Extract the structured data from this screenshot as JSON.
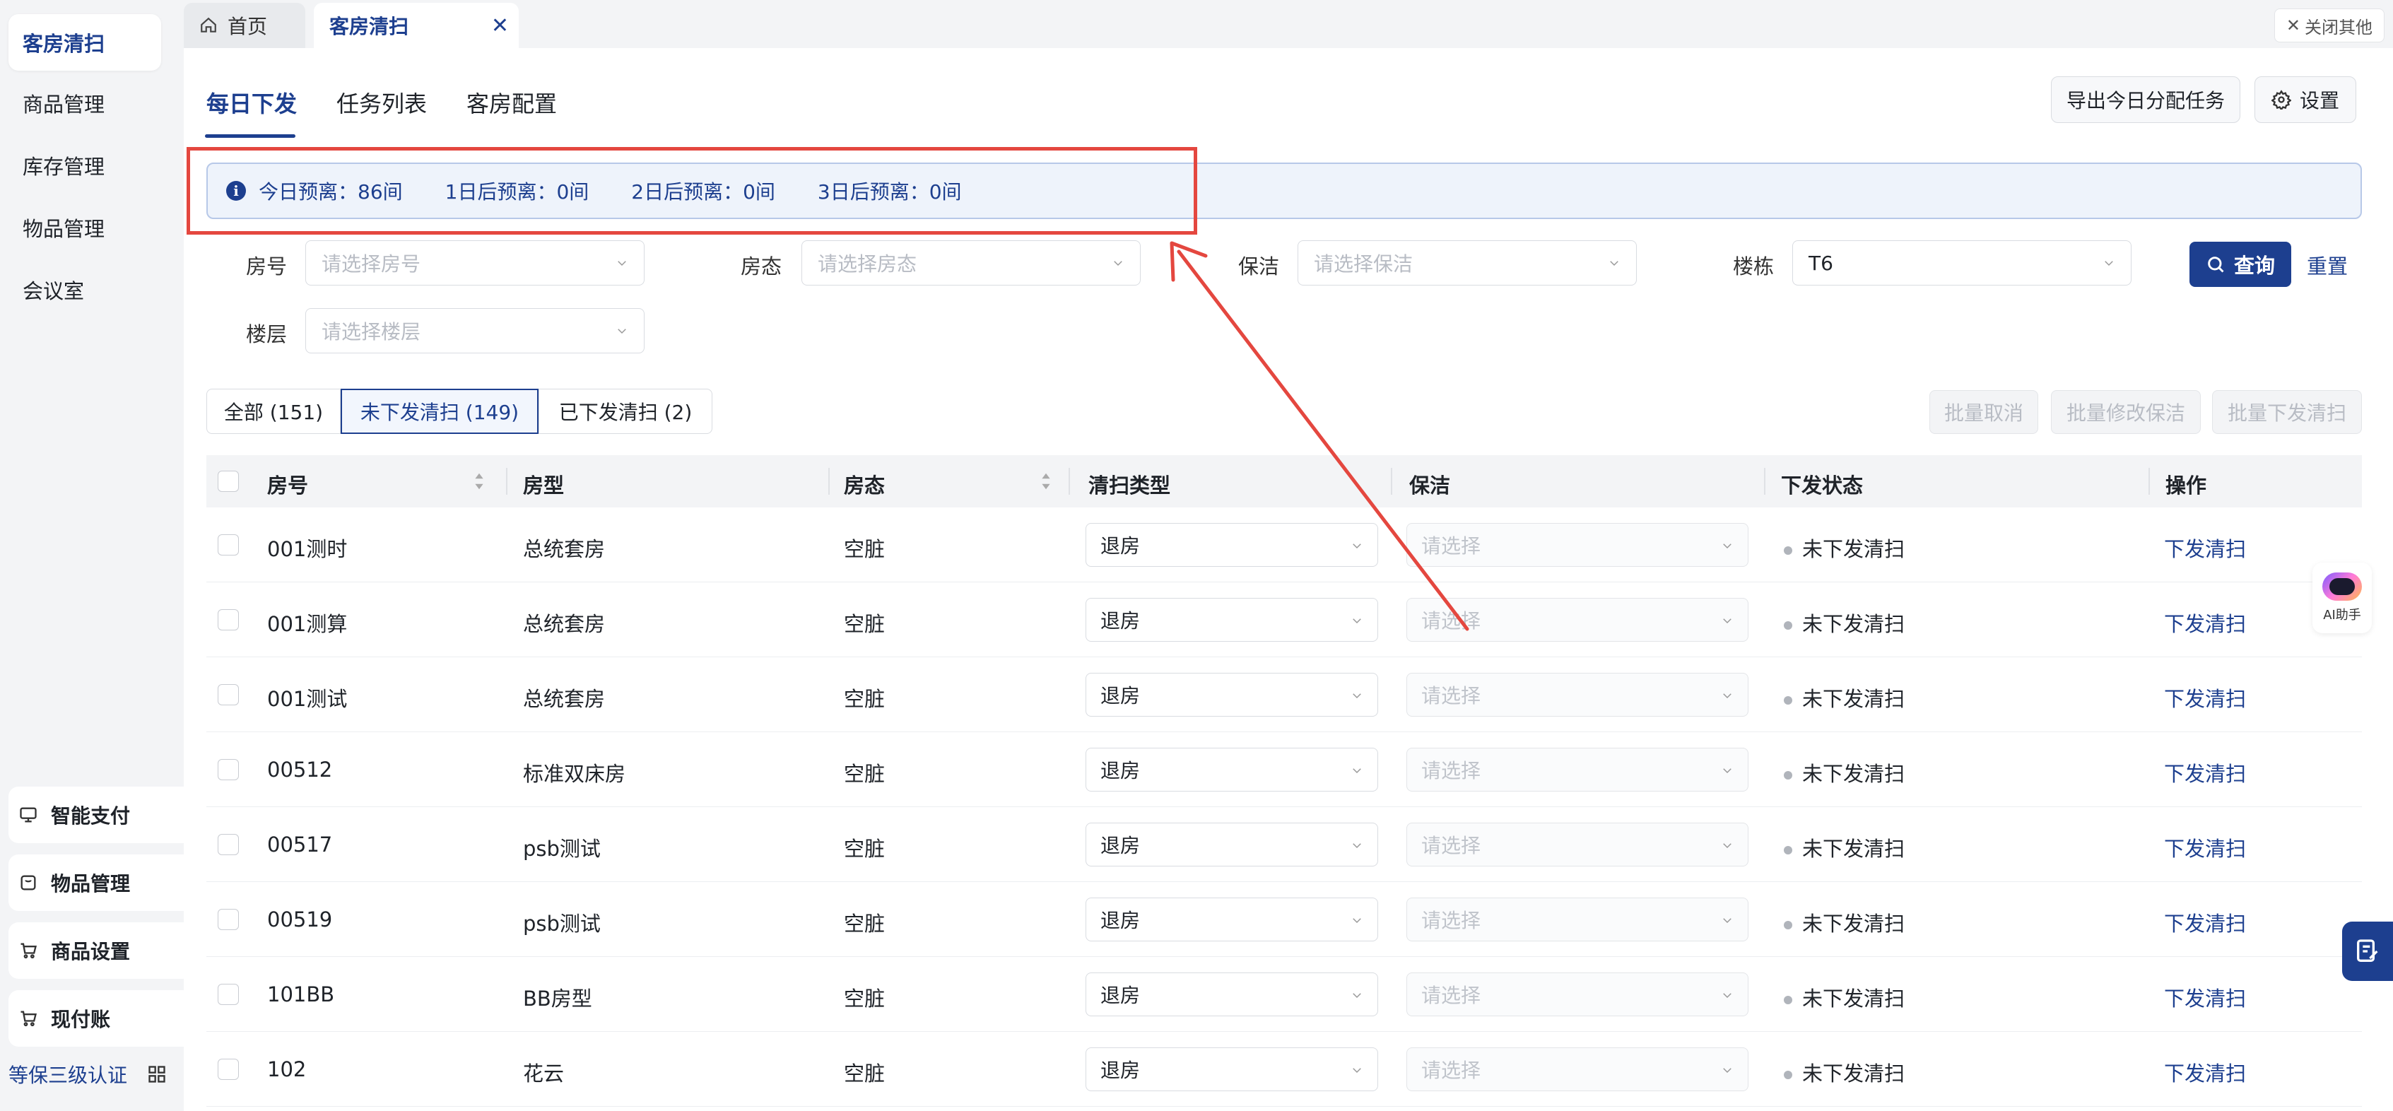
{
  "sidebar": {
    "items": [
      {
        "label": "客房清扫",
        "active": true
      },
      {
        "label": "商品管理"
      },
      {
        "label": "库存管理"
      },
      {
        "label": "物品管理"
      },
      {
        "label": "会议室"
      }
    ],
    "bottom_items": [
      {
        "label": "智能支付",
        "icon": "monitor-icon"
      },
      {
        "label": "物品管理",
        "icon": "box-icon"
      },
      {
        "label": "商品设置",
        "icon": "cart-icon"
      },
      {
        "label": "现付账",
        "icon": "cart-icon"
      }
    ],
    "cert_label": "等保三级认证"
  },
  "tabs": {
    "home": "首页",
    "active": "客房清扫",
    "close_others": "关闭其他"
  },
  "subtabs": [
    "每日下发",
    "任务列表",
    "客房配置"
  ],
  "toolbar": {
    "export_label": "导出今日分配任务",
    "settings_label": "设置"
  },
  "info": {
    "items": [
      "今日预离：86间",
      "1日后预离：0间",
      "2日后预离：0间",
      "3日后预离：0间"
    ]
  },
  "filters": {
    "room_label": "房号",
    "room_placeholder": "请选择房号",
    "status_label": "房态",
    "status_placeholder": "请选择房态",
    "cleaner_label": "保洁",
    "cleaner_placeholder": "请选择保洁",
    "building_label": "楼栋",
    "building_value": "T6",
    "floor_label": "楼层",
    "floor_placeholder": "请选择楼层",
    "query_label": "查询",
    "reset_label": "重置"
  },
  "segments": [
    "全部 (151)",
    "未下发清扫 (149)",
    "已下发清扫 (2)"
  ],
  "batch": [
    "批量取消",
    "批量修改保洁",
    "批量下发清扫"
  ],
  "table": {
    "headers": [
      "房号",
      "房型",
      "房态",
      "清扫类型",
      "保洁",
      "下发状态",
      "操作"
    ],
    "rows": [
      {
        "room": "001测时",
        "type": "总统套房",
        "status": "空脏",
        "clean": "退房",
        "cleaner": "请选择",
        "state": "未下发清扫",
        "op": "下发清扫"
      },
      {
        "room": "001测算",
        "type": "总统套房",
        "status": "空脏",
        "clean": "退房",
        "cleaner": "请选择",
        "state": "未下发清扫",
        "op": "下发清扫"
      },
      {
        "room": "001测试",
        "type": "总统套房",
        "status": "空脏",
        "clean": "退房",
        "cleaner": "请选择",
        "state": "未下发清扫",
        "op": "下发清扫"
      },
      {
        "room": "00512",
        "type": "标准双床房",
        "status": "空脏",
        "clean": "退房",
        "cleaner": "请选择",
        "state": "未下发清扫",
        "op": "下发清扫"
      },
      {
        "room": "00517",
        "type": "psb测试",
        "status": "空脏",
        "clean": "退房",
        "cleaner": "请选择",
        "state": "未下发清扫",
        "op": "下发清扫"
      },
      {
        "room": "00519",
        "type": "psb测试",
        "status": "空脏",
        "clean": "退房",
        "cleaner": "请选择",
        "state": "未下发清扫",
        "op": "下发清扫"
      },
      {
        "room": "101BB",
        "type": "BB房型",
        "status": "空脏",
        "clean": "退房",
        "cleaner": "请选择",
        "state": "未下发清扫",
        "op": "下发清扫"
      },
      {
        "room": "102",
        "type": "花云",
        "status": "空脏",
        "clean": "退房",
        "cleaner": "请选择",
        "state": "未下发清扫",
        "op": "下发清扫"
      }
    ]
  },
  "ai_assistant": "AI助手",
  "colors": {
    "accent": "#1d3f8f",
    "annotation": "#e4473f"
  }
}
